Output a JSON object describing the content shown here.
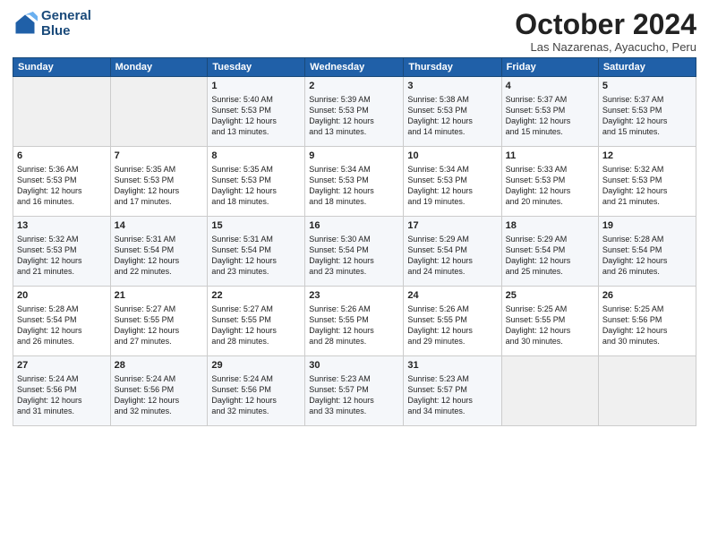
{
  "logo": {
    "line1": "General",
    "line2": "Blue"
  },
  "title": "October 2024",
  "location": "Las Nazarenas, Ayacucho, Peru",
  "headers": [
    "Sunday",
    "Monday",
    "Tuesday",
    "Wednesday",
    "Thursday",
    "Friday",
    "Saturday"
  ],
  "weeks": [
    [
      {
        "day": "",
        "info": ""
      },
      {
        "day": "",
        "info": ""
      },
      {
        "day": "1",
        "info": "Sunrise: 5:40 AM\nSunset: 5:53 PM\nDaylight: 12 hours\nand 13 minutes."
      },
      {
        "day": "2",
        "info": "Sunrise: 5:39 AM\nSunset: 5:53 PM\nDaylight: 12 hours\nand 13 minutes."
      },
      {
        "day": "3",
        "info": "Sunrise: 5:38 AM\nSunset: 5:53 PM\nDaylight: 12 hours\nand 14 minutes."
      },
      {
        "day": "4",
        "info": "Sunrise: 5:37 AM\nSunset: 5:53 PM\nDaylight: 12 hours\nand 15 minutes."
      },
      {
        "day": "5",
        "info": "Sunrise: 5:37 AM\nSunset: 5:53 PM\nDaylight: 12 hours\nand 15 minutes."
      }
    ],
    [
      {
        "day": "6",
        "info": "Sunrise: 5:36 AM\nSunset: 5:53 PM\nDaylight: 12 hours\nand 16 minutes."
      },
      {
        "day": "7",
        "info": "Sunrise: 5:35 AM\nSunset: 5:53 PM\nDaylight: 12 hours\nand 17 minutes."
      },
      {
        "day": "8",
        "info": "Sunrise: 5:35 AM\nSunset: 5:53 PM\nDaylight: 12 hours\nand 18 minutes."
      },
      {
        "day": "9",
        "info": "Sunrise: 5:34 AM\nSunset: 5:53 PM\nDaylight: 12 hours\nand 18 minutes."
      },
      {
        "day": "10",
        "info": "Sunrise: 5:34 AM\nSunset: 5:53 PM\nDaylight: 12 hours\nand 19 minutes."
      },
      {
        "day": "11",
        "info": "Sunrise: 5:33 AM\nSunset: 5:53 PM\nDaylight: 12 hours\nand 20 minutes."
      },
      {
        "day": "12",
        "info": "Sunrise: 5:32 AM\nSunset: 5:53 PM\nDaylight: 12 hours\nand 21 minutes."
      }
    ],
    [
      {
        "day": "13",
        "info": "Sunrise: 5:32 AM\nSunset: 5:53 PM\nDaylight: 12 hours\nand 21 minutes."
      },
      {
        "day": "14",
        "info": "Sunrise: 5:31 AM\nSunset: 5:54 PM\nDaylight: 12 hours\nand 22 minutes."
      },
      {
        "day": "15",
        "info": "Sunrise: 5:31 AM\nSunset: 5:54 PM\nDaylight: 12 hours\nand 23 minutes."
      },
      {
        "day": "16",
        "info": "Sunrise: 5:30 AM\nSunset: 5:54 PM\nDaylight: 12 hours\nand 23 minutes."
      },
      {
        "day": "17",
        "info": "Sunrise: 5:29 AM\nSunset: 5:54 PM\nDaylight: 12 hours\nand 24 minutes."
      },
      {
        "day": "18",
        "info": "Sunrise: 5:29 AM\nSunset: 5:54 PM\nDaylight: 12 hours\nand 25 minutes."
      },
      {
        "day": "19",
        "info": "Sunrise: 5:28 AM\nSunset: 5:54 PM\nDaylight: 12 hours\nand 26 minutes."
      }
    ],
    [
      {
        "day": "20",
        "info": "Sunrise: 5:28 AM\nSunset: 5:54 PM\nDaylight: 12 hours\nand 26 minutes."
      },
      {
        "day": "21",
        "info": "Sunrise: 5:27 AM\nSunset: 5:55 PM\nDaylight: 12 hours\nand 27 minutes."
      },
      {
        "day": "22",
        "info": "Sunrise: 5:27 AM\nSunset: 5:55 PM\nDaylight: 12 hours\nand 28 minutes."
      },
      {
        "day": "23",
        "info": "Sunrise: 5:26 AM\nSunset: 5:55 PM\nDaylight: 12 hours\nand 28 minutes."
      },
      {
        "day": "24",
        "info": "Sunrise: 5:26 AM\nSunset: 5:55 PM\nDaylight: 12 hours\nand 29 minutes."
      },
      {
        "day": "25",
        "info": "Sunrise: 5:25 AM\nSunset: 5:55 PM\nDaylight: 12 hours\nand 30 minutes."
      },
      {
        "day": "26",
        "info": "Sunrise: 5:25 AM\nSunset: 5:56 PM\nDaylight: 12 hours\nand 30 minutes."
      }
    ],
    [
      {
        "day": "27",
        "info": "Sunrise: 5:24 AM\nSunset: 5:56 PM\nDaylight: 12 hours\nand 31 minutes."
      },
      {
        "day": "28",
        "info": "Sunrise: 5:24 AM\nSunset: 5:56 PM\nDaylight: 12 hours\nand 32 minutes."
      },
      {
        "day": "29",
        "info": "Sunrise: 5:24 AM\nSunset: 5:56 PM\nDaylight: 12 hours\nand 32 minutes."
      },
      {
        "day": "30",
        "info": "Sunrise: 5:23 AM\nSunset: 5:57 PM\nDaylight: 12 hours\nand 33 minutes."
      },
      {
        "day": "31",
        "info": "Sunrise: 5:23 AM\nSunset: 5:57 PM\nDaylight: 12 hours\nand 34 minutes."
      },
      {
        "day": "",
        "info": ""
      },
      {
        "day": "",
        "info": ""
      }
    ]
  ]
}
